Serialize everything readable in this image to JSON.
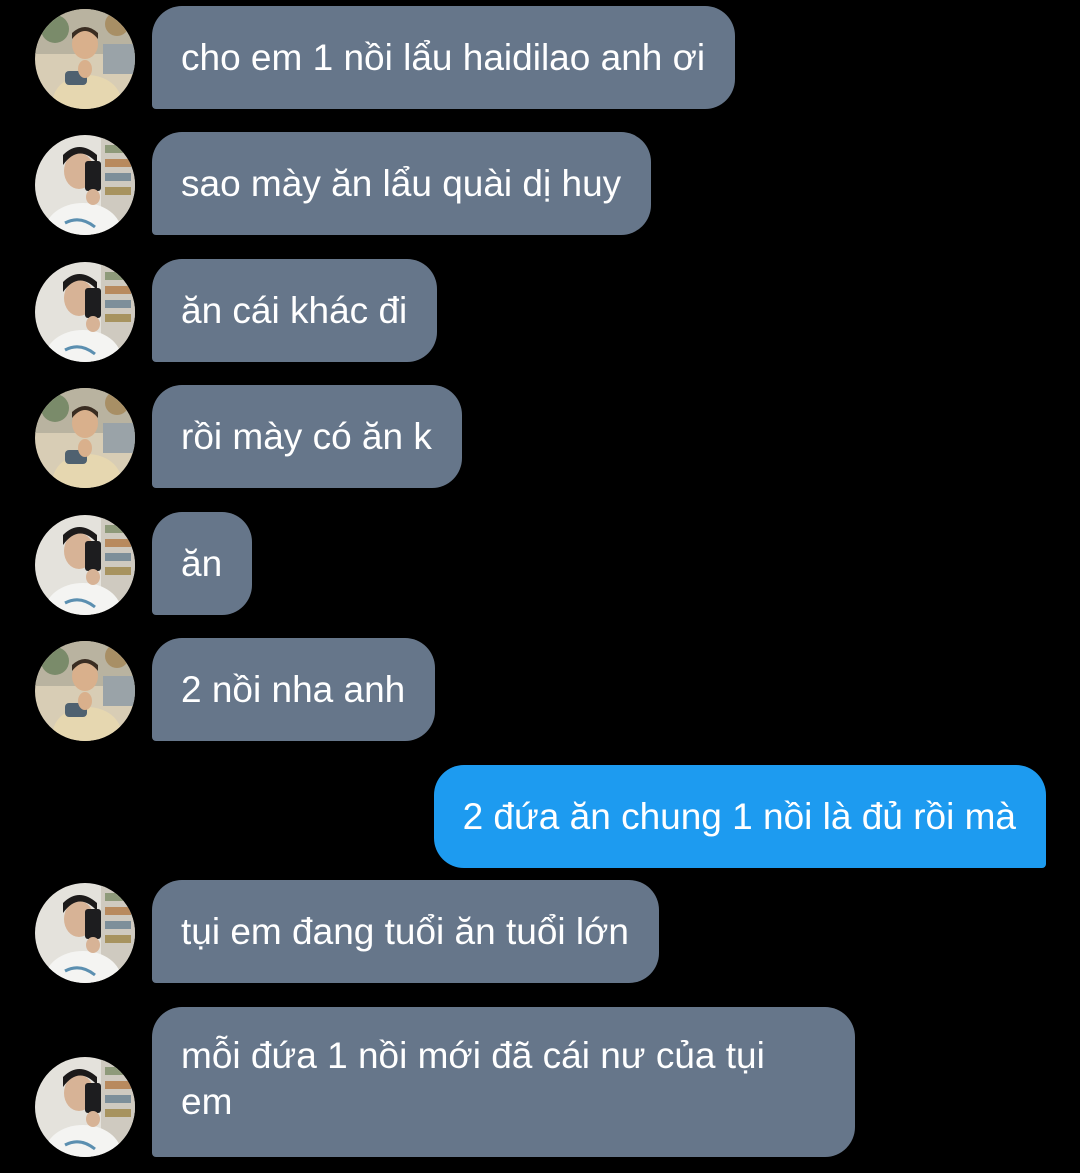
{
  "colors": {
    "background": "#000000",
    "incoming_bubble": "#66768a",
    "outgoing_bubble": "#1d9bf0",
    "text": "#ffffff"
  },
  "conversation": {
    "messages": [
      {
        "direction": "incoming",
        "avatar": "avatar-a",
        "text": "cho em 1 nồi lẩu haidilao anh ơi"
      },
      {
        "direction": "incoming",
        "avatar": "avatar-b",
        "text": "sao mày ăn lẩu quài dị huy"
      },
      {
        "direction": "incoming",
        "avatar": "avatar-b",
        "text": "ăn cái khác đi"
      },
      {
        "direction": "incoming",
        "avatar": "avatar-a",
        "text": "rồi mày có ăn k"
      },
      {
        "direction": "incoming",
        "avatar": "avatar-b",
        "text": "ăn"
      },
      {
        "direction": "incoming",
        "avatar": "avatar-a",
        "text": "2 nồi nha anh"
      },
      {
        "direction": "outgoing",
        "text": "2 đứa ăn chung 1 nồi là đủ rồi mà"
      },
      {
        "direction": "incoming",
        "avatar": "avatar-b",
        "text": "tụi em đang tuổi ăn tuổi lớn"
      },
      {
        "direction": "incoming",
        "avatar": "avatar-b",
        "text": "mỗi đứa 1 nồi mới đã cái nư của tụi em"
      }
    ]
  }
}
